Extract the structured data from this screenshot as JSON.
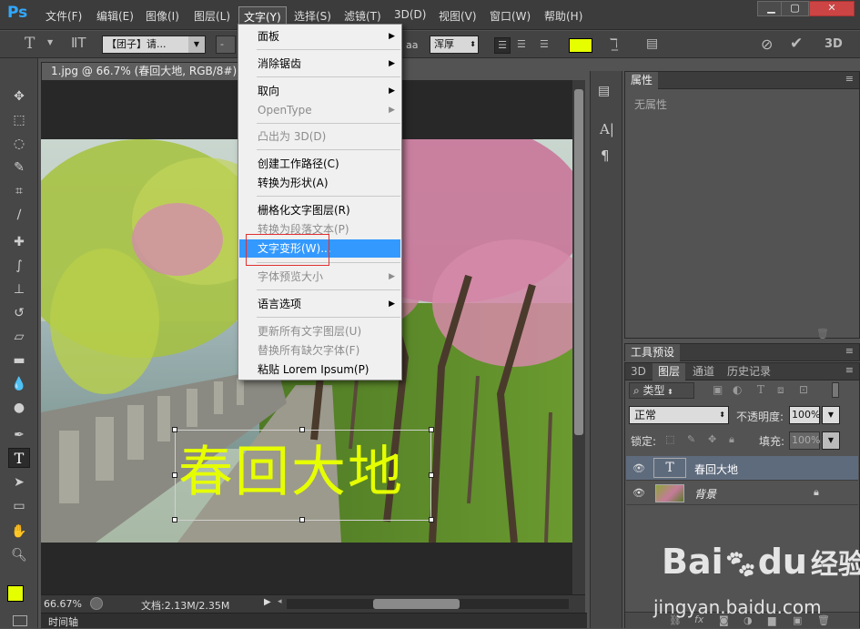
{
  "app": {
    "logo": "Ps"
  },
  "menubar": {
    "items": [
      "文件(F)",
      "编辑(E)",
      "图像(I)",
      "图层(L)",
      "文字(Y)",
      "选择(S)",
      "滤镜(T)",
      "3D(D)",
      "视图(V)",
      "窗口(W)",
      "帮助(H)"
    ],
    "active": "文字(Y)"
  },
  "window_controls": {
    "minimize": "▁",
    "restore": "▢",
    "close": "✕"
  },
  "options_bar": {
    "tool_glyph": "T",
    "font_family": "【团子】请...",
    "font_size": "-",
    "antialias": "浑厚",
    "text_color": "#e6ff00",
    "aa_glyph": "aa"
  },
  "document": {
    "tab_title": "1.jpg @ 66.7% (春回大地, RGB/8#) *",
    "zoom": "66.67%",
    "doc_info": "文档:2.13M/2.35M",
    "canvas_text": "春回大地",
    "canvas_text_color": "#e6ff00",
    "timeline_label": "时间轴"
  },
  "text_menu": {
    "items": [
      {
        "label": "面板",
        "submenu": true,
        "enabled": true
      },
      {
        "label": "消除锯齿",
        "submenu": true,
        "enabled": true
      },
      {
        "label": "取向",
        "submenu": true,
        "enabled": true
      },
      {
        "label": "OpenType",
        "submenu": true,
        "enabled": false
      },
      {
        "label": "凸出为 3D(D)",
        "submenu": false,
        "enabled": false
      },
      {
        "label": "创建工作路径(C)",
        "submenu": false,
        "enabled": true
      },
      {
        "label": "转换为形状(A)",
        "submenu": false,
        "enabled": true
      },
      {
        "label": "栅格化文字图层(R)",
        "submenu": false,
        "enabled": true
      },
      {
        "label": "转换为段落文本(P)",
        "submenu": false,
        "enabled": false
      },
      {
        "label": "文字变形(W)...",
        "submenu": false,
        "enabled": true,
        "highlighted": true
      },
      {
        "label": "字体预览大小",
        "submenu": true,
        "enabled": false
      },
      {
        "label": "语言选项",
        "submenu": true,
        "enabled": true
      },
      {
        "label": "更新所有文字图层(U)",
        "submenu": false,
        "enabled": false
      },
      {
        "label": "替换所有缺欠字体(F)",
        "submenu": false,
        "enabled": false
      },
      {
        "label": "粘贴 Lorem Ipsum(P)",
        "submenu": false,
        "enabled": true
      }
    ]
  },
  "properties_panel": {
    "tab": "属性",
    "empty_text": "无属性"
  },
  "tool_presets_panel": {
    "tab": "工具预设"
  },
  "layers_panel": {
    "tabs": [
      "3D",
      "图层",
      "通道",
      "历史记录"
    ],
    "active_tab": "图层",
    "filter_kind": "类型",
    "blend_mode": "正常",
    "opacity_label": "不透明度:",
    "opacity_value": "100%",
    "lock_label": "锁定:",
    "fill_label": "填充:",
    "fill_value": "100%",
    "layers": [
      {
        "name": "春回大地",
        "type": "text",
        "selected": true
      },
      {
        "name": "背景",
        "type": "image",
        "selected": false,
        "locked": true
      }
    ]
  },
  "watermark": {
    "brand": "Bai",
    "brand2": "du",
    "cn": "经验",
    "url": "jingyan.baidu.com"
  },
  "colors": {
    "menu_highlight": "#3399ff",
    "foreground": "#e6ff00",
    "background": "#ffffff",
    "annotation_box": "#e03030"
  }
}
